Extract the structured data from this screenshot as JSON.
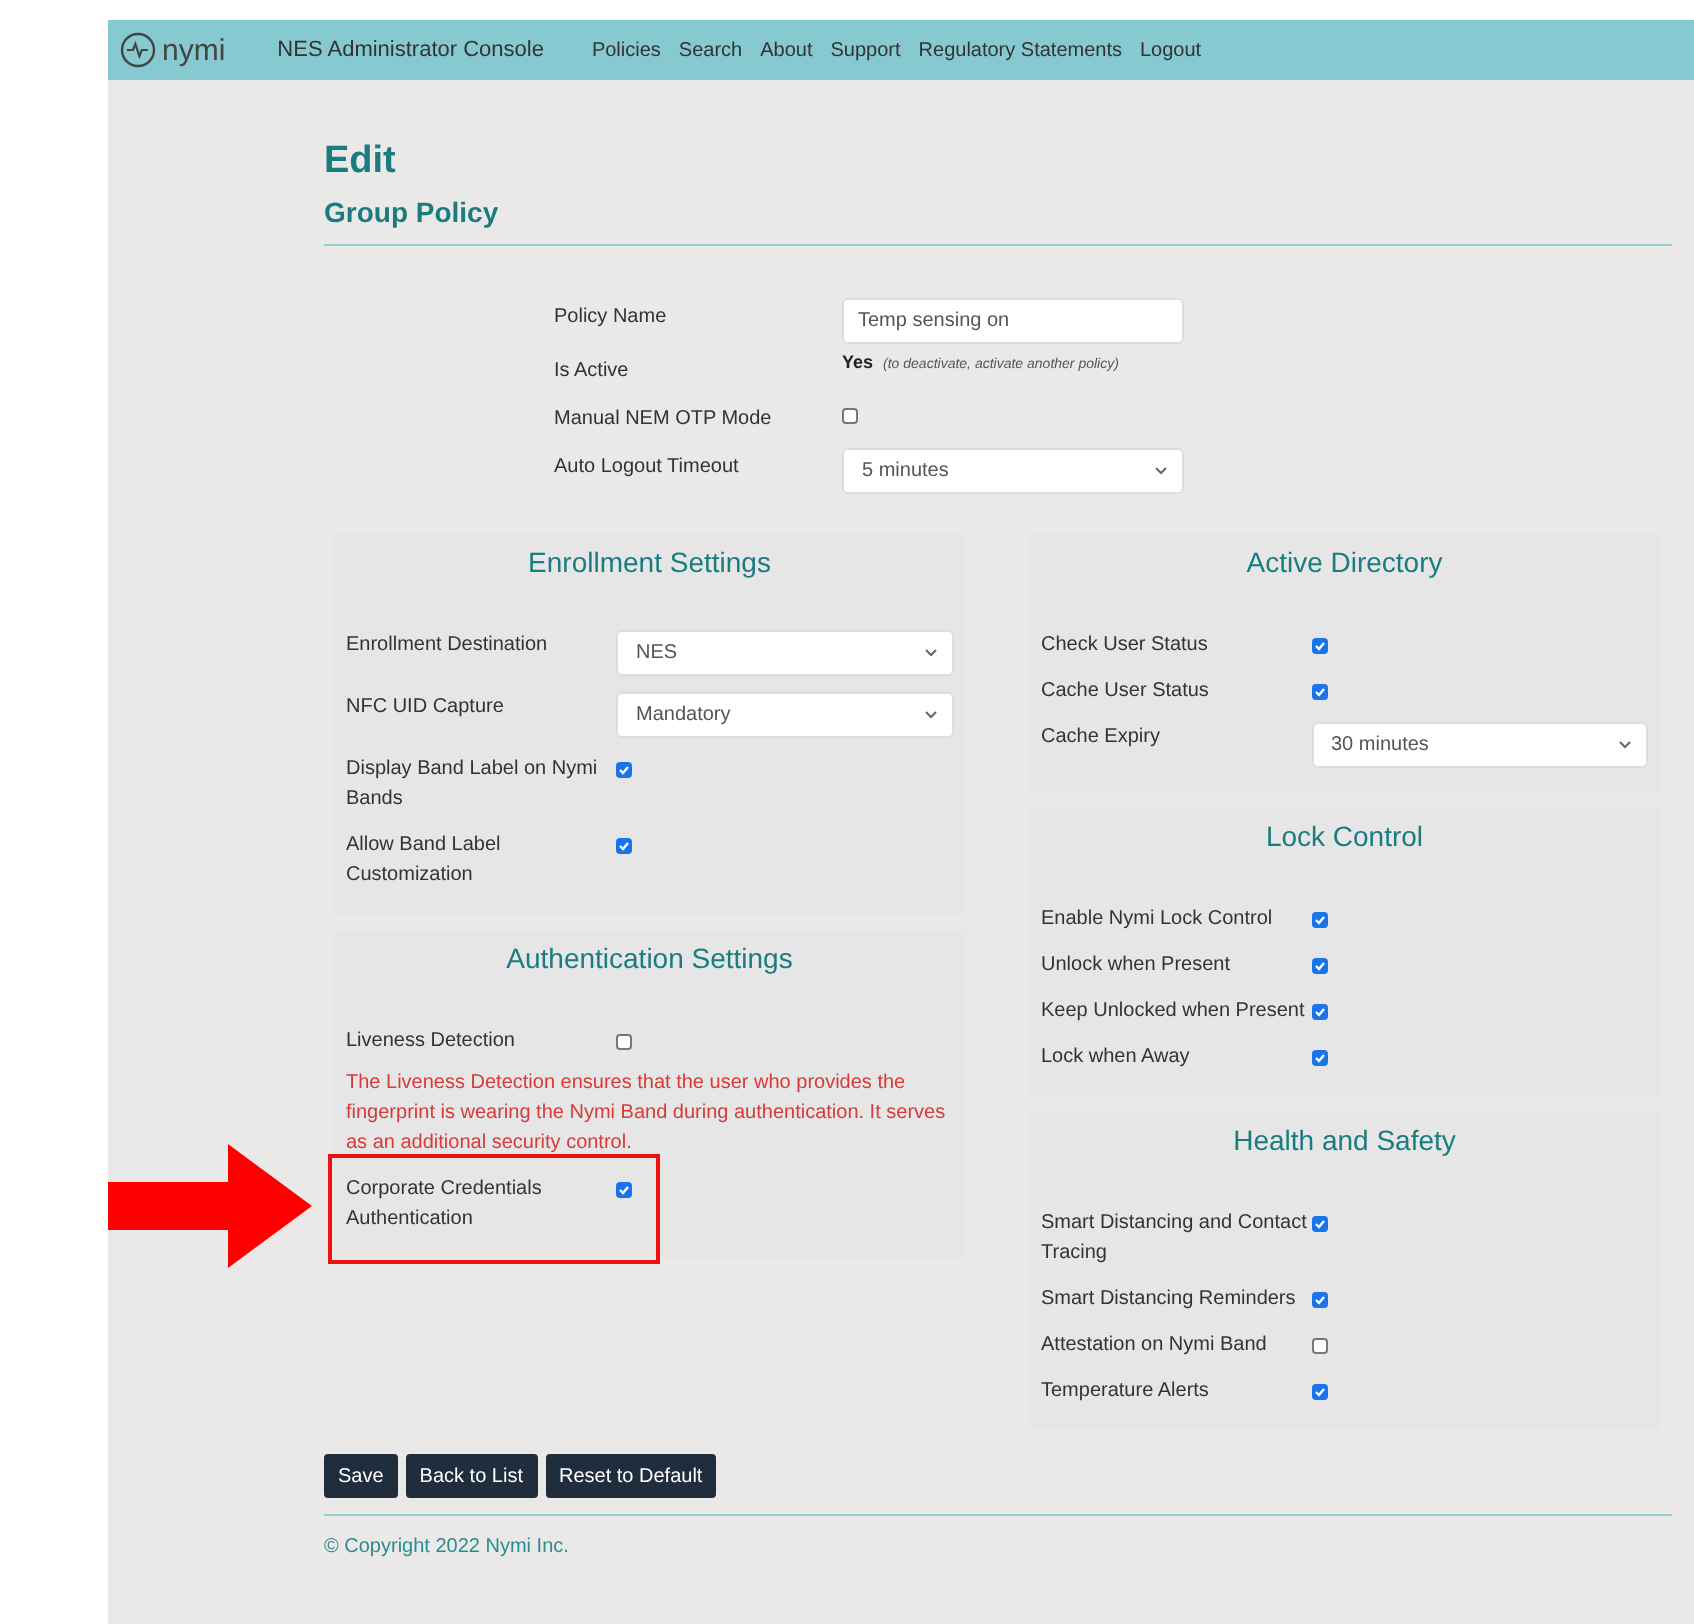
{
  "navbar": {
    "brand": "nymi",
    "title": "NES Administrator Console",
    "links": [
      "Policies",
      "Search",
      "About",
      "Support",
      "Regulatory Statements",
      "Logout"
    ]
  },
  "heading": "Edit",
  "subheading": "Group Policy",
  "policy_fields": [
    {
      "kind": "text",
      "label": "Policy Name",
      "value": "Temp sensing on"
    },
    {
      "kind": "status",
      "label": "Is Active",
      "value": "Yes",
      "note": "(to deactivate, activate another policy)"
    },
    {
      "kind": "checkbox",
      "label": "Manual NEM OTP Mode",
      "checked": false
    },
    {
      "kind": "select",
      "label": "Auto Logout Timeout",
      "value": "5 minutes"
    }
  ],
  "columns": [
    [
      {
        "title": "Enrollment Settings",
        "fields": [
          {
            "kind": "select",
            "label": "Enrollment Destination",
            "value": "NES"
          },
          {
            "kind": "select",
            "label": "NFC UID Capture",
            "value": "Mandatory"
          },
          {
            "kind": "checkbox",
            "label": "Display Band Label on Nymi Bands",
            "checked": true
          },
          {
            "kind": "checkbox",
            "label": "Allow Band Label Customization",
            "checked": true
          }
        ]
      },
      {
        "title": "Authentication Settings",
        "fields": [
          {
            "kind": "checkbox",
            "label": "Liveness Detection",
            "checked": false
          },
          {
            "kind": "note",
            "text": "The Liveness Detection ensures that the user who provides the fingerprint is wearing the Nymi Band during authentication. It serves as an additional security control."
          },
          {
            "kind": "checkbox",
            "label": "Corporate Credentials Authentication",
            "checked": true,
            "highlighted": true
          }
        ]
      }
    ],
    [
      {
        "title": "Active Directory",
        "fields": [
          {
            "kind": "checkbox",
            "label": "Check User Status",
            "checked": true
          },
          {
            "kind": "checkbox",
            "label": "Cache User Status",
            "checked": true
          },
          {
            "kind": "select",
            "label": "Cache Expiry",
            "value": "30 minutes"
          }
        ]
      },
      {
        "title": "Lock Control",
        "fields": [
          {
            "kind": "checkbox",
            "label": "Enable Nymi Lock Control",
            "checked": true
          },
          {
            "kind": "checkbox",
            "label": "Unlock when Present",
            "checked": true
          },
          {
            "kind": "checkbox",
            "label": "Keep Unlocked when Present",
            "checked": true
          },
          {
            "kind": "checkbox",
            "label": "Lock when Away",
            "checked": true
          }
        ]
      },
      {
        "title": "Health and Safety",
        "fields": [
          {
            "kind": "checkbox",
            "label": "Smart Distancing and Contact Tracing",
            "checked": true
          },
          {
            "kind": "checkbox",
            "label": "Smart Distancing Reminders",
            "checked": true
          },
          {
            "kind": "checkbox",
            "label": "Attestation on Nymi Band",
            "checked": false
          },
          {
            "kind": "checkbox",
            "label": "Temperature Alerts",
            "checked": true
          }
        ]
      }
    ]
  ],
  "buttons": [
    "Save",
    "Back to List",
    "Reset to Default"
  ],
  "copyright": "© Copyright 2022 Nymi Inc."
}
